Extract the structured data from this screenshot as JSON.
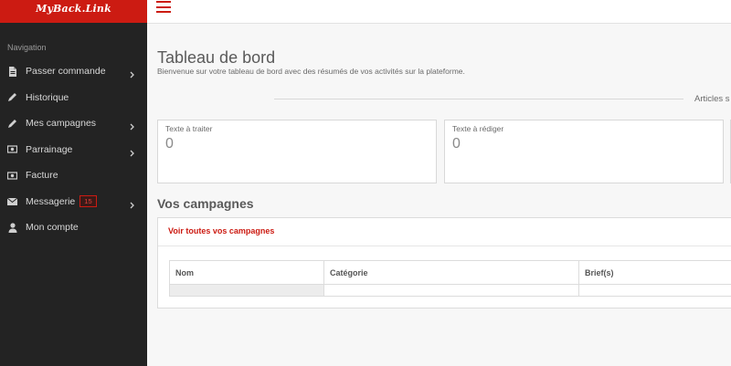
{
  "logo": {
    "text": "MyBack.Link"
  },
  "sidebar": {
    "heading": "Navigation",
    "items": [
      {
        "label": "Passer commande",
        "icon": "document-icon",
        "has_chevron": true
      },
      {
        "label": "Historique",
        "icon": "pencil-icon",
        "has_chevron": false
      },
      {
        "label": "Mes campagnes",
        "icon": "pencil-icon",
        "has_chevron": true
      },
      {
        "label": "Parrainage",
        "icon": "money-icon",
        "has_chevron": true
      },
      {
        "label": "Facture",
        "icon": "money-icon",
        "has_chevron": false
      },
      {
        "label": "Messagerie",
        "icon": "envelope-icon",
        "has_chevron": true,
        "badge": "15"
      },
      {
        "label": "Mon compte",
        "icon": "user-icon",
        "has_chevron": false
      }
    ]
  },
  "header": {
    "menu_icon": "hamburger-icon"
  },
  "main": {
    "title": "Tableau de bord",
    "subtitle": "Bienvenue sur votre tableau de bord avec des résumés de vos activités sur la plateforme.",
    "divider_label": "Articles s",
    "stats": [
      {
        "label": "Texte à traiter",
        "value": "0"
      },
      {
        "label": "Texte à rédiger",
        "value": "0"
      }
    ],
    "campaigns": {
      "title": "Vos campagnes",
      "link": "Voir toutes vos campagnes",
      "columns": [
        "Nom",
        "Catégorie",
        "Brief(s)"
      ]
    }
  },
  "colors": {
    "brand": "#cc1b12",
    "sidebar_bg": "#232323"
  }
}
